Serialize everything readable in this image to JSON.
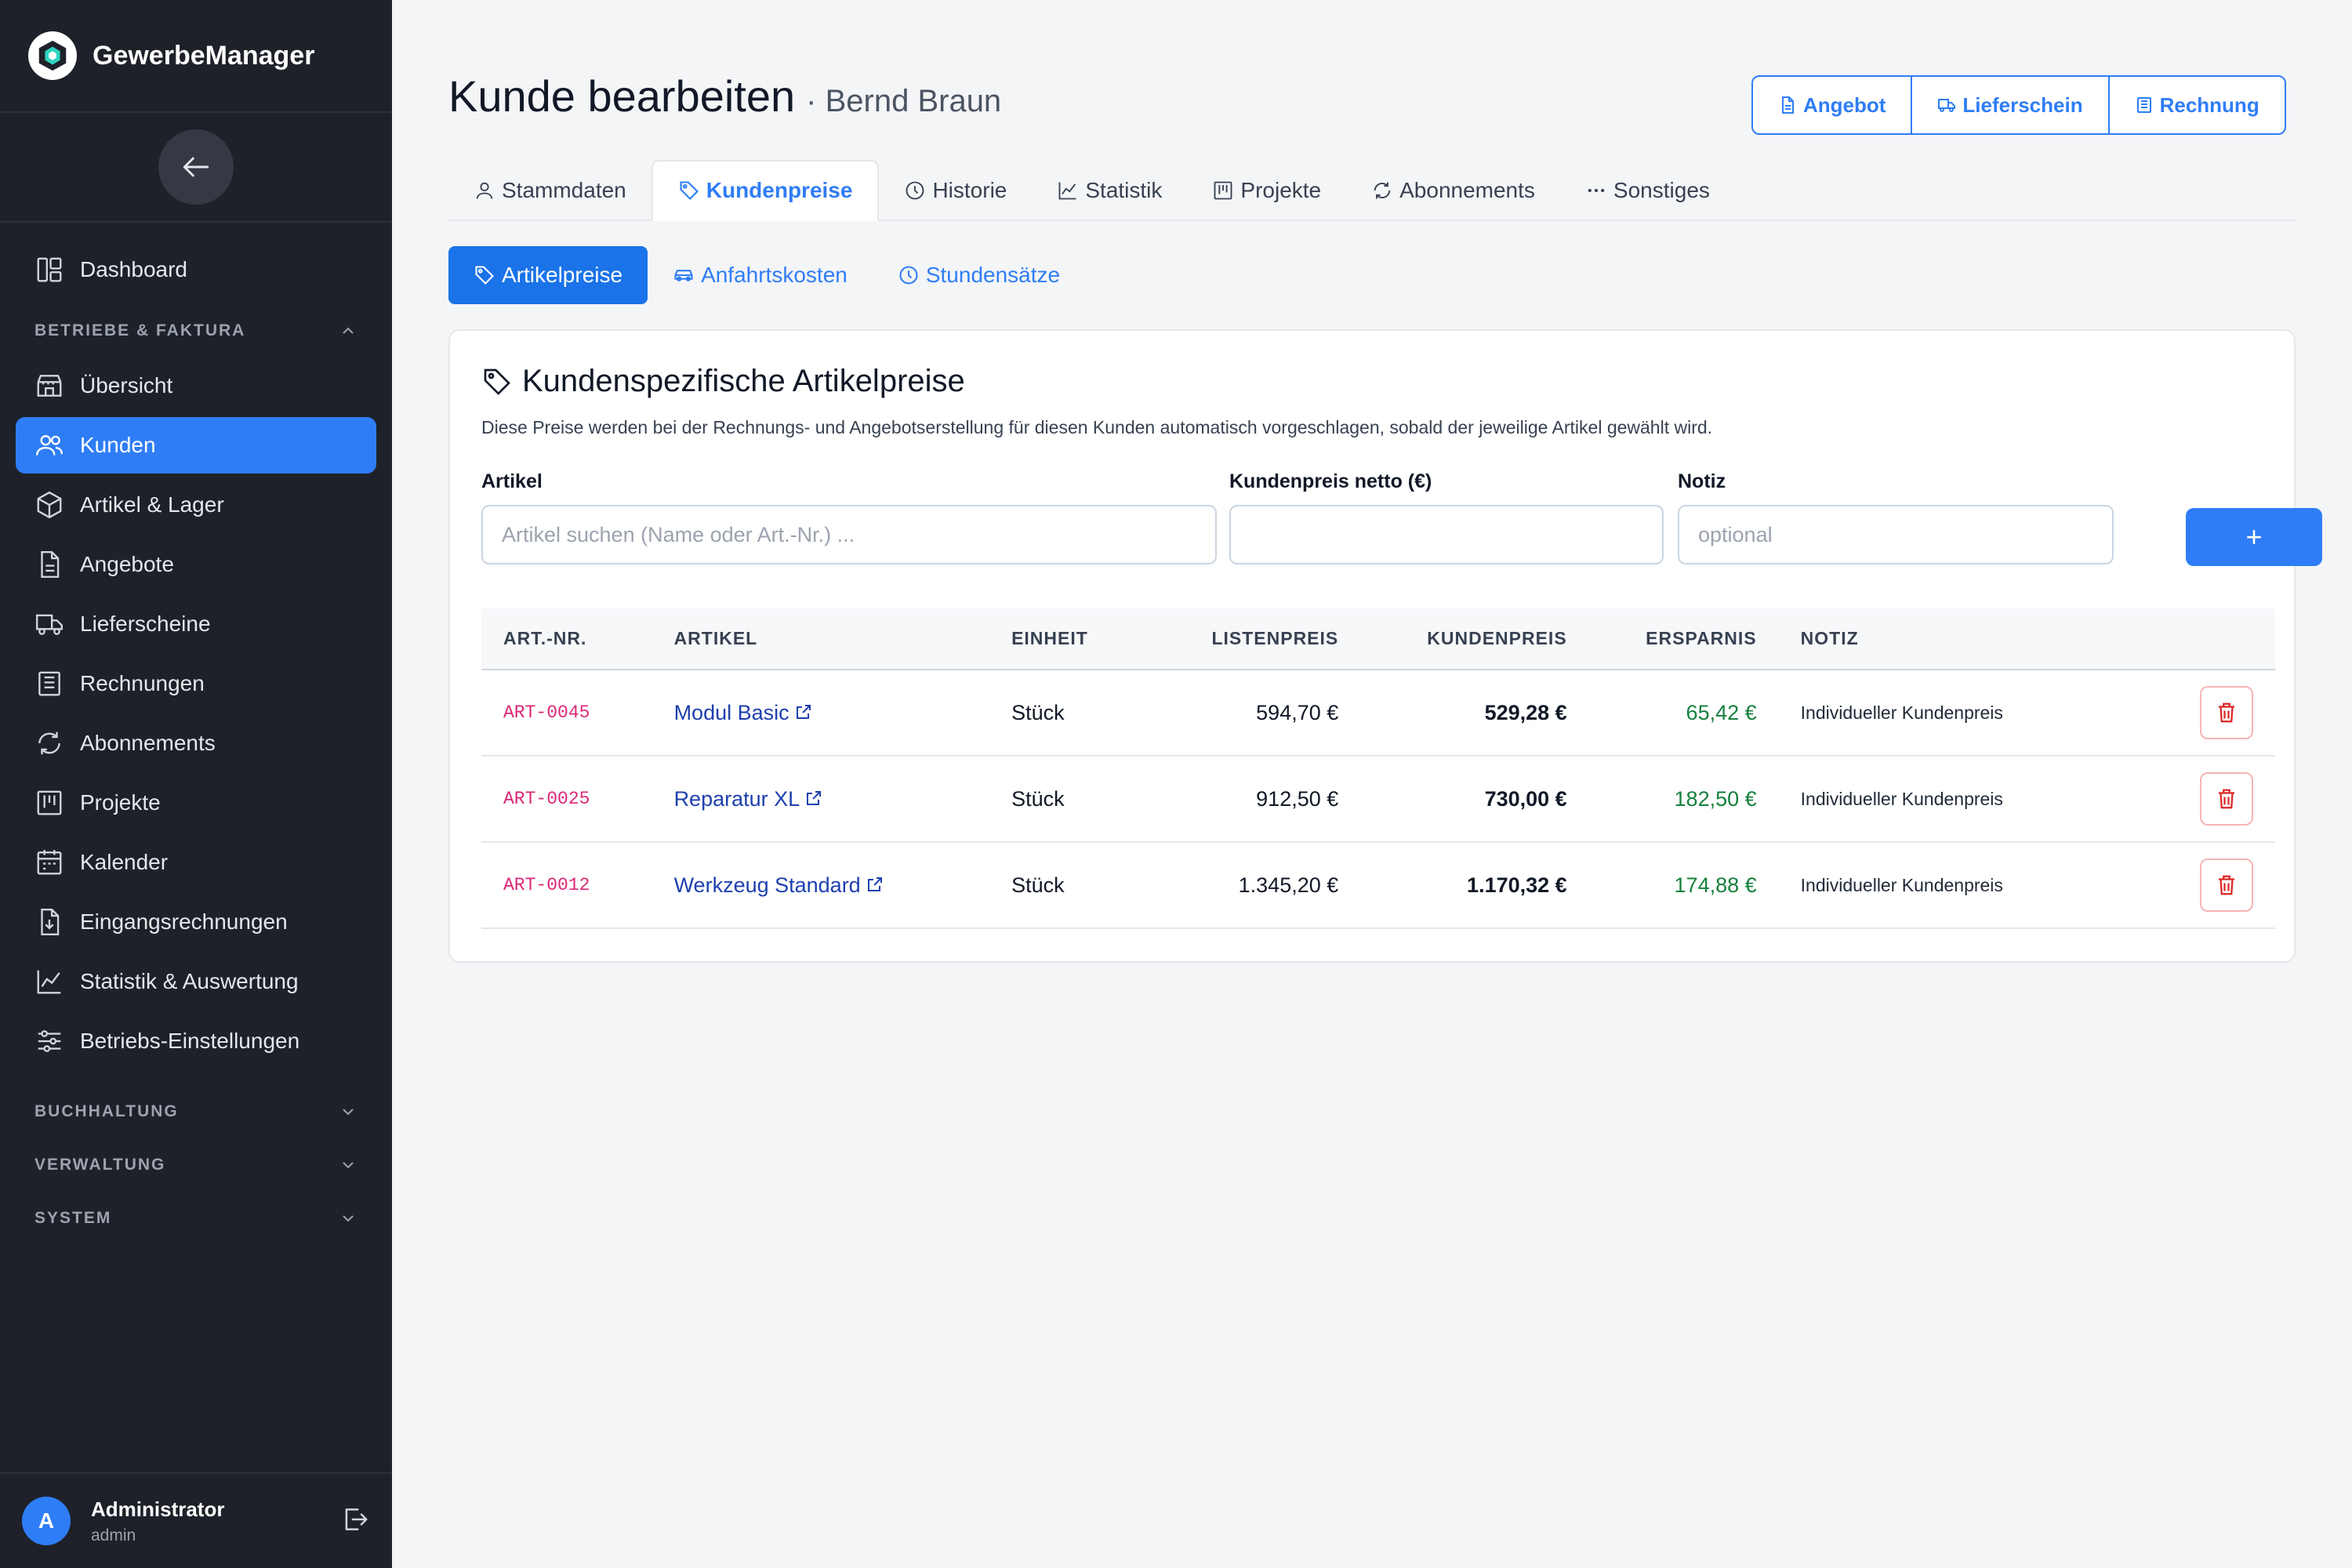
{
  "app": {
    "name": "GewerbeManager"
  },
  "sidebar": {
    "items_top": [
      {
        "label": "Dashboard",
        "icon": "dashboard-icon"
      }
    ],
    "section_betriebe": {
      "label": "BETRIEBE & FAKTURA"
    },
    "items": [
      {
        "label": "Übersicht",
        "icon": "store-icon"
      },
      {
        "label": "Kunden",
        "icon": "users-icon",
        "active": true
      },
      {
        "label": "Artikel & Lager",
        "icon": "box-icon"
      },
      {
        "label": "Angebote",
        "icon": "document-icon"
      },
      {
        "label": "Lieferscheine",
        "icon": "truck-icon"
      },
      {
        "label": "Rechnungen",
        "icon": "invoice-icon"
      },
      {
        "label": "Abonnements",
        "icon": "refresh-icon"
      },
      {
        "label": "Projekte",
        "icon": "kanban-icon"
      },
      {
        "label": "Kalender",
        "icon": "calendar-icon"
      },
      {
        "label": "Eingangsrechnungen",
        "icon": "download-doc-icon"
      },
      {
        "label": "Statistik & Auswertung",
        "icon": "chart-icon"
      },
      {
        "label": "Betriebs-Einstellungen",
        "icon": "sliders-icon"
      }
    ],
    "sections_collapsed": [
      "BUCHHALTUNG",
      "VERWALTUNG",
      "SYSTEM"
    ],
    "user": {
      "initial": "A",
      "name": "Administrator",
      "role": "admin"
    }
  },
  "header": {
    "title": "Kunde bearbeiten",
    "subtitle": "· Bernd Braun",
    "buttons": {
      "angebot": "Angebot",
      "lieferschein": "Lieferschein",
      "rechnung": "Rechnung"
    }
  },
  "tabs": [
    {
      "label": "Stammdaten",
      "icon": "user-icon"
    },
    {
      "label": "Kundenpreise",
      "icon": "tag-icon",
      "active": true
    },
    {
      "label": "Historie",
      "icon": "clock-icon"
    },
    {
      "label": "Statistik",
      "icon": "chart-icon"
    },
    {
      "label": "Projekte",
      "icon": "kanban-icon"
    },
    {
      "label": "Abonnements",
      "icon": "refresh-icon"
    },
    {
      "label": "Sonstiges",
      "icon": "dots-icon"
    }
  ],
  "subtabs": [
    {
      "label": "Artikelpreise",
      "icon": "tag-icon",
      "active": true
    },
    {
      "label": "Anfahrtskosten",
      "icon": "car-icon"
    },
    {
      "label": "Stundensätze",
      "icon": "clock-icon"
    }
  ],
  "card": {
    "title": "Kundenspezifische Artikelpreise",
    "description": "Diese Preise werden bei der Rechnungs- und Angebotserstellung für diesen Kunden automatisch vorgeschlagen, sobald der jeweilige Artikel gewählt wird.",
    "form": {
      "artikel_label": "Artikel",
      "artikel_placeholder": "Artikel suchen (Name oder Art.-Nr.) ...",
      "preis_label": "Kundenpreis netto (€)",
      "preis_value": "",
      "notiz_label": "Notiz",
      "notiz_placeholder": "optional",
      "add_label": "+"
    },
    "table": {
      "headers": [
        "ART.-NR.",
        "ARTIKEL",
        "EINHEIT",
        "LISTENPREIS",
        "KUNDENPREIS",
        "ERSPARNIS",
        "NOTIZ"
      ],
      "rows": [
        {
          "nr": "ART-0045",
          "artikel": "Modul Basic",
          "einheit": "Stück",
          "listenpreis": "594,70 €",
          "kundenpreis": "529,28 €",
          "ersparnis": "65,42 €",
          "notiz": "Individueller Kundenpreis"
        },
        {
          "nr": "ART-0025",
          "artikel": "Reparatur XL",
          "einheit": "Stück",
          "listenpreis": "912,50 €",
          "kundenpreis": "730,00 €",
          "ersparnis": "182,50 €",
          "notiz": "Individueller Kundenpreis"
        },
        {
          "nr": "ART-0012",
          "artikel": "Werkzeug Standard",
          "einheit": "Stück",
          "listenpreis": "1.345,20 €",
          "kundenpreis": "1.170,32 €",
          "ersparnis": "174,88 €",
          "notiz": "Individueller Kundenpreis"
        }
      ]
    }
  },
  "colors": {
    "accent": "#2f7df6",
    "sidebar_bg": "#1e2129",
    "code": "#db2777",
    "saving": "#15803d",
    "danger": "#dc2626"
  }
}
